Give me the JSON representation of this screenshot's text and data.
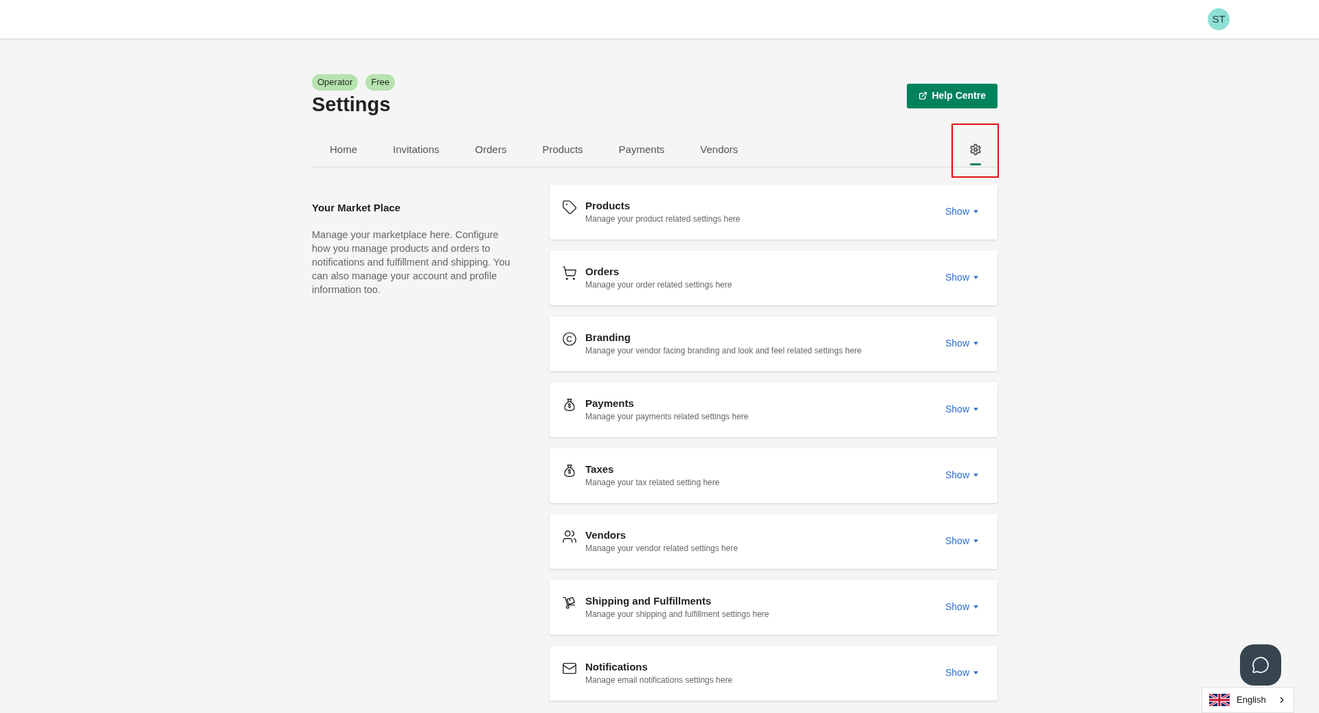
{
  "header": {
    "avatar": "ST"
  },
  "page": {
    "badges": [
      "Operator",
      "Free"
    ],
    "title": "Settings",
    "help_button": "Help Centre"
  },
  "tabs": [
    {
      "kind": "text",
      "label": "Home",
      "selected": false
    },
    {
      "kind": "text",
      "label": "Invitations",
      "selected": false
    },
    {
      "kind": "text",
      "label": "Orders",
      "selected": false
    },
    {
      "kind": "text",
      "label": "Products",
      "selected": false
    },
    {
      "kind": "text",
      "label": "Payments",
      "selected": false
    },
    {
      "kind": "text",
      "label": "Vendors",
      "selected": false
    },
    {
      "kind": "gear",
      "selected": true,
      "highlighted": true
    }
  ],
  "intro": {
    "heading": "Your Market Place",
    "text": "Manage your marketplace here. Configure how you manage products and orders to notifications and fulfillment and shipping. You can also manage your account and profile information too."
  },
  "sections": [
    {
      "kind": "tag",
      "title": "Products",
      "subtitle": "Manage your product related settings here",
      "toggle": "Show",
      "expanded": false
    },
    {
      "kind": "cart",
      "title": "Orders",
      "subtitle": "Manage your order related settings here",
      "toggle": "Show",
      "expanded": false
    },
    {
      "kind": "copyright",
      "title": "Branding",
      "subtitle": "Manage your vendor facing branding and look and feel related settings here",
      "toggle": "Show",
      "expanded": false
    },
    {
      "kind": "moneybag",
      "title": "Payments",
      "subtitle": "Manage your payments related settings here",
      "toggle": "Show",
      "expanded": false
    },
    {
      "kind": "moneybag",
      "title": "Taxes",
      "subtitle": "Manage your tax related setting here",
      "toggle": "Show",
      "expanded": false
    },
    {
      "kind": "users",
      "title": "Vendors",
      "subtitle": "Manage your vendor related settings here",
      "toggle": "Show",
      "expanded": false
    },
    {
      "kind": "dolly",
      "title": "Shipping and Fulfillments",
      "subtitle": "Manage your shipping and fulfillment settings here",
      "toggle": "Show",
      "expanded": false
    },
    {
      "kind": "mail",
      "title": "Notifications",
      "subtitle": "Manage email notifications settings here",
      "toggle": "Show",
      "expanded": false
    }
  ],
  "language": {
    "label": "English"
  }
}
